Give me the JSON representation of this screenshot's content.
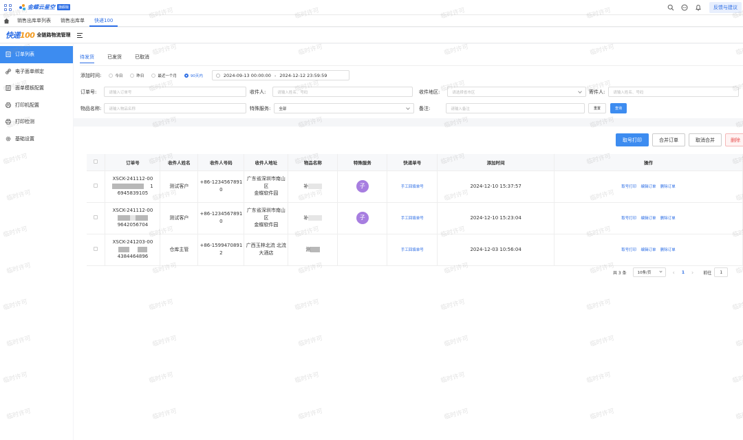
{
  "header": {
    "brand": "金蝶云星空",
    "brand_badge": "旗舰版",
    "feedback_label": "反馈与建议"
  },
  "tabs": [
    "销售出库单列表",
    "销售出库单",
    "快递100"
  ],
  "app": {
    "logo_main": "快递",
    "logo_num": "100",
    "subtitle": "全链路物流管理"
  },
  "sidebar": {
    "items": [
      {
        "label": "订单列表",
        "icon": "list-icon",
        "active": true
      },
      {
        "label": "电子面单绑定",
        "icon": "link-icon"
      },
      {
        "label": "面单模板配置",
        "icon": "template-icon"
      },
      {
        "label": "打印机配置",
        "icon": "printer-icon"
      },
      {
        "label": "打印检测",
        "icon": "printer-check-icon"
      },
      {
        "label": "基础设置",
        "icon": "gear-icon"
      }
    ]
  },
  "status_tabs": [
    "待发货",
    "已发货",
    "已取消"
  ],
  "filters": {
    "time_label": "添加时间:",
    "time_options": [
      "今日",
      "昨日",
      "最近一个月",
      "90天内"
    ],
    "date_start": "2024-09-13 00:00:00",
    "date_sep": "-",
    "date_end": "2024-12-12 23:59:59",
    "order_no_label": "订单号:",
    "order_no_placeholder": "请输入订单号",
    "receiver_label": "收件人:",
    "receiver_placeholder": "请输入姓名、号码",
    "region_label": "收件地区:",
    "region_placeholder": "请选择省市区",
    "sender_label": "寄件人:",
    "sender_placeholder": "请输入姓名、号码",
    "goods_label": "物品名称:",
    "goods_placeholder": "请输入物品名称",
    "service_label": "特殊服务:",
    "service_value": "全部",
    "remark_label": "备注:",
    "remark_placeholder": "请输入备注",
    "reset_label": "重置",
    "query_label": "查询"
  },
  "actions": {
    "print": "取号打印",
    "merge": "合并订单",
    "unmerge": "取消合并",
    "delete": "删除"
  },
  "table": {
    "headers": [
      "订单号",
      "收件人姓名",
      "收件人号码",
      "收件人地址",
      "物品名称",
      "特殊服务",
      "快递单号",
      "添加时间",
      "操作"
    ],
    "rows": [
      {
        "order_prefix": "XSCK-241112-00",
        "order_mid_suffix": "1",
        "order_tail": "6945839105",
        "name": "测试客户",
        "phone_a": "+86-1234567891",
        "phone_b": "0",
        "addr_a": "广东省深圳市南山区",
        "addr_b": "金蝶软件园",
        "goods": "补",
        "service": "子",
        "express": "手工回填单号",
        "time": "2024-12-10 15:37:57"
      },
      {
        "order_prefix": "XSCK-241112-00",
        "order_mid_suffix": "",
        "order_tail": "9642056704",
        "name": "测试客户",
        "phone_a": "+86-1234567891",
        "phone_b": "0",
        "addr_a": "广东省深圳市南山区",
        "addr_b": "金蝶软件园",
        "goods": "补",
        "service": "子",
        "express": "手工回填单号",
        "time": "2024-12-10 15:23:04"
      },
      {
        "order_prefix": "XSCK-241203-00",
        "order_mid_suffix": "",
        "order_tail": "4384464896",
        "name": "仓库主管",
        "phone_a": "+86-1599470891",
        "phone_b": "2",
        "addr_a": "广西玉林北流 北流",
        "addr_b": "大酒店",
        "goods": "测",
        "service": "",
        "express": "手工回填单号",
        "time": "2024-12-03 10:56:04"
      }
    ],
    "row_ops": [
      "取号打印",
      "编辑订单",
      "删除订单"
    ]
  },
  "pagination": {
    "total": "共 3 条",
    "page_size": "10条/页",
    "current": "1",
    "goto_label": "前往",
    "goto_value": "1"
  },
  "watermark": "临时许可",
  "colors": {
    "primary": "#3d8cf0",
    "link": "#2b6de5",
    "avatar": "#a77ee0",
    "danger": "#e85050"
  }
}
